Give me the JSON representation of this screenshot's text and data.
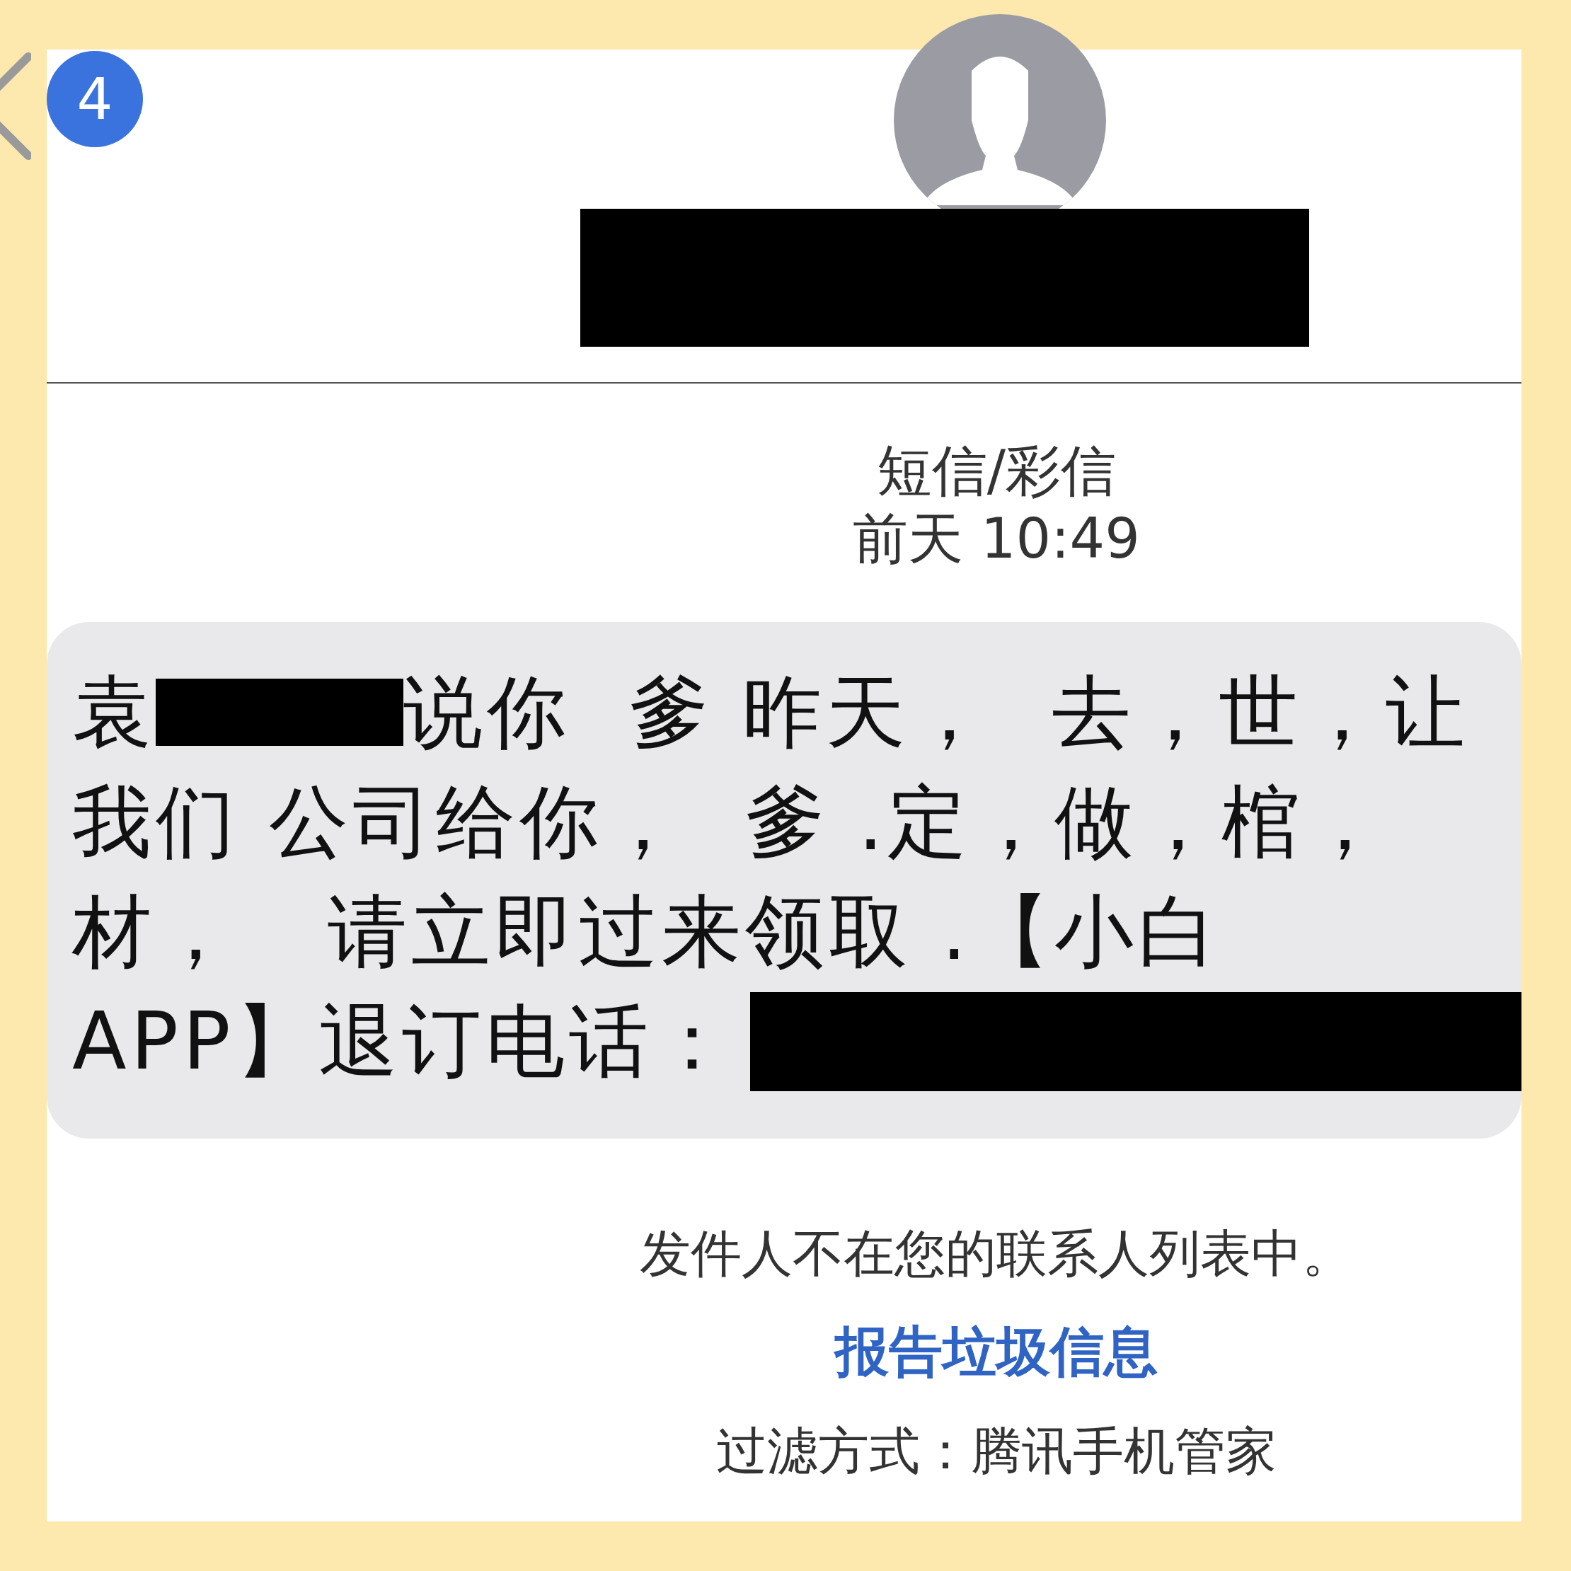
{
  "header": {
    "unread_badge": "4"
  },
  "message_meta": {
    "service": "短信/彩信",
    "time": "前天 10:49"
  },
  "message": {
    "lines": [
      [
        {
          "kind": "text",
          "text": "袁"
        },
        {
          "kind": "redacted"
        },
        {
          "kind": "text",
          "text": "说你  爹 昨天，  去，世，让"
        }
      ],
      [
        {
          "kind": "text",
          "text": "我们 公司给你，  爹 .定，做，棺，"
        }
      ],
      [
        {
          "kind": "text",
          "text": "材，   请立即过来领取 .【小白"
        }
      ],
      [
        {
          "kind": "text",
          "text": "APP】退订电话："
        },
        {
          "kind": "redacted"
        }
      ]
    ]
  },
  "footer": {
    "notice": "发件人不在您的联系人列表中。",
    "report_link": "报告垃圾信息",
    "filter_text": "过滤方式：腾讯手机管家"
  }
}
